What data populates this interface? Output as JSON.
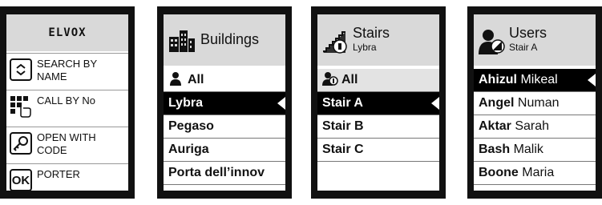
{
  "screen1": {
    "brand": "ELVOX",
    "menu": [
      {
        "label": "SEARCH BY NAME",
        "icon": "search-scroll-icon"
      },
      {
        "label": "CALL BY No",
        "icon": "keypad-icon"
      },
      {
        "label": "OPEN WITH CODE",
        "icon": "key-icon"
      },
      {
        "label": "PORTER",
        "icon": "ok-icon",
        "icon_text": "OK"
      }
    ]
  },
  "screen2": {
    "title": "Buildings",
    "icon": "buildings-icon",
    "items": [
      "All",
      "Lybra",
      "Pegaso",
      "Auriga",
      "Porta dell’innov"
    ],
    "selected_index": 1
  },
  "screen3": {
    "title": "Stairs",
    "subtitle": "Lybra",
    "icon": "stairs-icon",
    "items": [
      "All",
      "Stair A",
      "Stair B",
      "Stair C"
    ],
    "selected_index": 1
  },
  "screen4": {
    "title": "Users",
    "subtitle": "Stair A",
    "icon": "users-icon",
    "items": [
      {
        "first": "Ahizul",
        "last": "Mikeal"
      },
      {
        "first": "Angel",
        "last": "Numan"
      },
      {
        "first": "Aktar",
        "last": "Sarah"
      },
      {
        "first": "Bash",
        "last": "Malik"
      },
      {
        "first": "Boone",
        "last": "Maria"
      }
    ],
    "selected_index": 0
  },
  "colors": {
    "frame": "#111111",
    "header": "#d9d9d9",
    "selected": "#000000"
  }
}
